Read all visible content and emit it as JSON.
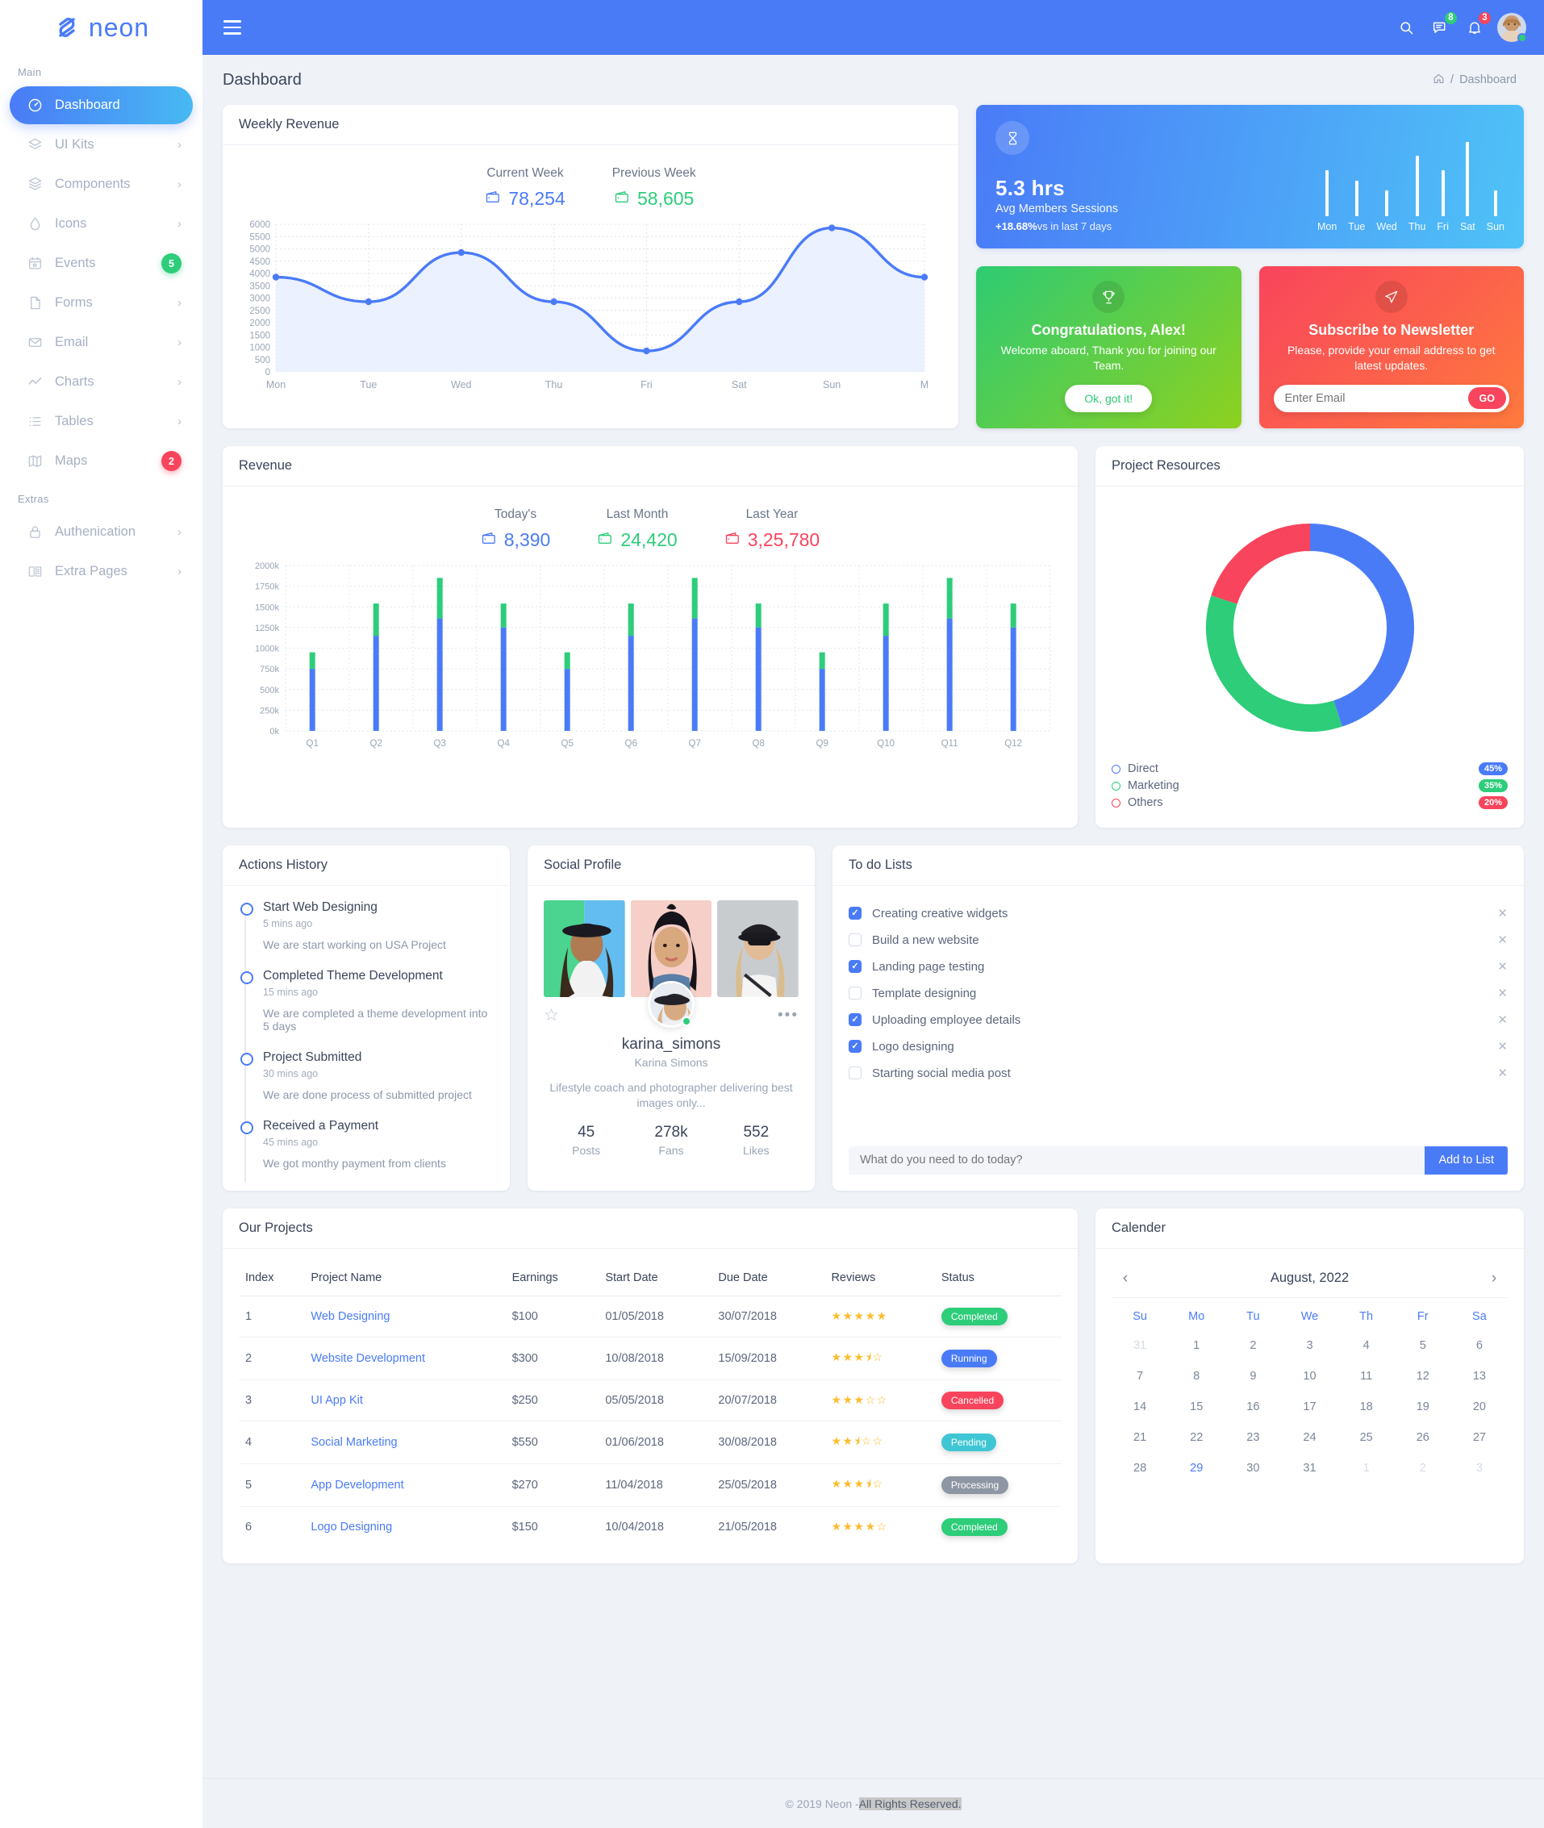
{
  "brand": {
    "name": "neon",
    "logo_icon": "neon-logo-icon"
  },
  "sidebar": {
    "section_main": "Main",
    "section_extras": "Extras",
    "items": [
      {
        "label": "Dashboard",
        "icon": "speedometer-icon",
        "active": true,
        "trailing": ""
      },
      {
        "label": "UI Kits",
        "icon": "layers-icon",
        "trailing": "chevron"
      },
      {
        "label": "Components",
        "icon": "box-icon",
        "trailing": "chevron"
      },
      {
        "label": "Icons",
        "icon": "droplet-icon",
        "trailing": "chevron"
      },
      {
        "label": "Events",
        "icon": "calendar-icon",
        "trailing": "badge",
        "badge": "5",
        "badge_color": "#2dcd7a"
      },
      {
        "label": "Forms",
        "icon": "file-icon",
        "trailing": "chevron"
      },
      {
        "label": "Email",
        "icon": "envelope-icon",
        "trailing": "chevron"
      },
      {
        "label": "Charts",
        "icon": "line-chart-icon",
        "trailing": "chevron"
      },
      {
        "label": "Tables",
        "icon": "list-icon",
        "trailing": "chevron"
      },
      {
        "label": "Maps",
        "icon": "map-icon",
        "trailing": "badge",
        "badge": "2",
        "badge_color": "#f8445c"
      }
    ],
    "extras": [
      {
        "label": "Authenication",
        "icon": "lock-icon",
        "trailing": "chevron"
      },
      {
        "label": "Extra Pages",
        "icon": "book-icon",
        "trailing": "chevron"
      }
    ]
  },
  "topbar": {
    "menu_icon": "hamburger-icon",
    "search_icon": "search-icon",
    "messages_icon": "message-icon",
    "messages_count": "8",
    "notifications_icon": "bell-icon",
    "notifications_count": "3",
    "avatar_icon": "user-avatar"
  },
  "header": {
    "page_title": "Dashboard",
    "breadcrumb_home_icon": "home-icon",
    "breadcrumb_sep": "/",
    "breadcrumb_current": "Dashboard"
  },
  "weekly_revenue": {
    "title": "Weekly Revenue",
    "stats": [
      {
        "label": "Current Week",
        "value": "78,254",
        "icon": "wallet-icon",
        "color": "#4a7bf7"
      },
      {
        "label": "Previous Week",
        "value": "58,605",
        "icon": "wallet-icon",
        "color": "#2dcd7a"
      }
    ]
  },
  "avg_session": {
    "icon": "hourglass-icon",
    "value": "5.3 hrs",
    "label": "Avg Members Sessions",
    "delta": "+18.68%",
    "delta_note": "vs in last 7 days"
  },
  "promo_congrats": {
    "icon": "trophy-icon",
    "title": "Congratulations, Alex!",
    "text": "Welcome aboard, Thank you for joining our Team.",
    "button": "Ok, got it!"
  },
  "promo_newsletter": {
    "icon": "send-icon",
    "title": "Subscribe to Newsletter",
    "text": "Please, provide your email address to get latest updates.",
    "input_placeholder": "Enter Email",
    "input_value": "",
    "button": "GO"
  },
  "revenue": {
    "title": "Revenue",
    "stats": [
      {
        "label": "Today's",
        "value": "8,390",
        "icon": "wallet-icon",
        "color": "#4a7bf7"
      },
      {
        "label": "Last Month",
        "value": "24,420",
        "icon": "wallet-icon",
        "color": "#2dcd7a"
      },
      {
        "label": "Last Year",
        "value": "3,25,780",
        "icon": "wallet-icon",
        "color": "#f8445c"
      }
    ]
  },
  "project_resources": {
    "title": "Project Resources"
  },
  "actions_history": {
    "title": "Actions History",
    "items": [
      {
        "title": "Start Web Designing",
        "time": "5 mins ago",
        "desc": "We are start working on USA Project"
      },
      {
        "title": "Completed Theme Development",
        "time": "15 mins ago",
        "desc": "We are completed a theme development into 5 days"
      },
      {
        "title": "Project Submitted",
        "time": "30 mins ago",
        "desc": "We are done process of submitted project"
      },
      {
        "title": "Received a Payment",
        "time": "45 mins ago",
        "desc": "We got monthy payment from clients"
      }
    ]
  },
  "social_profile": {
    "title": "Social Profile",
    "star_icon": "star-outline-icon",
    "more_icon": "more-dots-icon",
    "username": "karina_simons",
    "fullname": "Karina Simons",
    "bio": "Lifestyle coach and photographer delivering best images only...",
    "stats": [
      {
        "value": "45",
        "label": "Posts"
      },
      {
        "value": "278k",
        "label": "Fans"
      },
      {
        "value": "552",
        "label": "Likes"
      }
    ]
  },
  "todo": {
    "title": "To do Lists",
    "items": [
      {
        "label": "Creating creative widgets",
        "done": true
      },
      {
        "label": "Build a new website",
        "done": false
      },
      {
        "label": "Landing page testing",
        "done": true
      },
      {
        "label": "Template designing",
        "done": false
      },
      {
        "label": "Uploading employee details",
        "done": true
      },
      {
        "label": "Logo designing",
        "done": true
      },
      {
        "label": "Starting social media post",
        "done": false
      }
    ],
    "input_placeholder": "What do you need to do today?",
    "input_value": "",
    "add_button": "Add to List",
    "remove_icon": "close-icon"
  },
  "projects": {
    "title": "Our Projects",
    "columns": [
      "Index",
      "Project Name",
      "Earnings",
      "Start Date",
      "Due Date",
      "Reviews",
      "Status"
    ],
    "rows": [
      {
        "index": "1",
        "name": "Web Designing",
        "earnings": "$100",
        "start": "01/05/2018",
        "due": "30/07/2018",
        "rating": 5,
        "status": "Completed",
        "status_class": "st-completed"
      },
      {
        "index": "2",
        "name": "Website Development",
        "earnings": "$300",
        "start": "10/08/2018",
        "due": "15/09/2018",
        "rating": 3.5,
        "status": "Running",
        "status_class": "st-running"
      },
      {
        "index": "3",
        "name": "UI App Kit",
        "earnings": "$250",
        "start": "05/05/2018",
        "due": "20/07/2018",
        "rating": 3,
        "status": "Cancelled",
        "status_class": "st-cancelled"
      },
      {
        "index": "4",
        "name": "Social Marketing",
        "earnings": "$550",
        "start": "01/06/2018",
        "due": "30/08/2018",
        "rating": 2.5,
        "status": "Pending",
        "status_class": "st-pending"
      },
      {
        "index": "5",
        "name": "App Development",
        "earnings": "$270",
        "start": "11/04/2018",
        "due": "25/05/2018",
        "rating": 3.5,
        "status": "Processing",
        "status_class": "st-processing"
      },
      {
        "index": "6",
        "name": "Logo Designing",
        "earnings": "$150",
        "start": "10/04/2018",
        "due": "21/05/2018",
        "rating": 4,
        "status": "Completed",
        "status_class": "st-completed"
      }
    ]
  },
  "calendar": {
    "title": "Calender",
    "month": "August, 2022",
    "prev_icon": "chevron-left-icon",
    "next_icon": "chevron-right-icon",
    "dow": [
      "Su",
      "Mo",
      "Tu",
      "We",
      "Th",
      "Fr",
      "Sa"
    ],
    "weeks": [
      [
        {
          "d": "31",
          "mut": true
        },
        {
          "d": "1"
        },
        {
          "d": "2"
        },
        {
          "d": "3"
        },
        {
          "d": "4"
        },
        {
          "d": "5"
        },
        {
          "d": "6"
        }
      ],
      [
        {
          "d": "7"
        },
        {
          "d": "8"
        },
        {
          "d": "9"
        },
        {
          "d": "10"
        },
        {
          "d": "11"
        },
        {
          "d": "12"
        },
        {
          "d": "13"
        }
      ],
      [
        {
          "d": "14"
        },
        {
          "d": "15"
        },
        {
          "d": "16"
        },
        {
          "d": "17"
        },
        {
          "d": "18"
        },
        {
          "d": "19"
        },
        {
          "d": "20"
        }
      ],
      [
        {
          "d": "21"
        },
        {
          "d": "22"
        },
        {
          "d": "23"
        },
        {
          "d": "24"
        },
        {
          "d": "25"
        },
        {
          "d": "26"
        },
        {
          "d": "27"
        }
      ],
      [
        {
          "d": "28"
        },
        {
          "d": "29",
          "sel": true
        },
        {
          "d": "30"
        },
        {
          "d": "31"
        },
        {
          "d": "1",
          "mut": true
        },
        {
          "d": "2",
          "mut": true
        },
        {
          "d": "3",
          "mut": true
        }
      ]
    ]
  },
  "footer": {
    "text_before": "© 2019 Neon - ",
    "text_highlight": "All Rights Reserved."
  },
  "chart_data": [
    {
      "type": "area",
      "name": "weekly-revenue-line",
      "title": "Weekly Revenue",
      "categories": [
        "Mon",
        "Tue",
        "Wed",
        "Thu",
        "Fri",
        "Sat",
        "Sun",
        "M"
      ],
      "values": [
        3850,
        2850,
        4850,
        2850,
        850,
        2850,
        5850,
        3850
      ],
      "ylim": [
        0,
        6000
      ],
      "yticks": [
        0,
        500,
        1000,
        1500,
        2000,
        2500,
        3000,
        3500,
        4000,
        4500,
        5000,
        5500,
        6000
      ],
      "xlabel": "",
      "ylabel": "",
      "grid": true,
      "legend": "none",
      "color": "#4a7bf7",
      "fill": "#e8efff"
    },
    {
      "type": "bar",
      "name": "avg-session-minibars",
      "categories": [
        "Mon",
        "Tue",
        "Wed",
        "Thu",
        "Fri",
        "Sat",
        "Sun"
      ],
      "values": [
        62,
        48,
        35,
        82,
        62,
        100,
        35
      ],
      "ylim": [
        0,
        100
      ],
      "color": "#ffffff",
      "grid": false,
      "legend": "none"
    },
    {
      "type": "bar",
      "name": "revenue-stacked-bars",
      "title": "Revenue",
      "categories": [
        "Q1",
        "Q2",
        "Q3",
        "Q4",
        "Q5",
        "Q6",
        "Q7",
        "Q8",
        "Q9",
        "Q10",
        "Q11",
        "Q12"
      ],
      "series": [
        {
          "name": "Base",
          "color": "#4a7bf7",
          "values": [
            750000,
            1150000,
            1360000,
            1250000,
            750000,
            1150000,
            1360000,
            1250000,
            750000,
            1150000,
            1360000,
            1250000
          ]
        },
        {
          "name": "Top",
          "color": "#2dcd7a",
          "values": [
            200000,
            390000,
            490000,
            290000,
            200000,
            390000,
            490000,
            290000,
            200000,
            390000,
            490000,
            290000
          ]
        }
      ],
      "totals": [
        950000,
        1540000,
        1850000,
        1540000,
        950000,
        1540000,
        1850000,
        1540000,
        950000,
        1540000,
        1850000,
        1540000
      ],
      "ylim": [
        0,
        2000000
      ],
      "yticks": [
        "0k",
        "250k",
        "500k",
        "750k",
        "1000k",
        "1250k",
        "1500k",
        "1750k",
        "2000k"
      ],
      "grid": true,
      "legend": "none",
      "stacked": true
    },
    {
      "type": "pie",
      "name": "project-resources-donut",
      "title": "Project Resources",
      "labels": [
        "Direct",
        "Marketing",
        "Others"
      ],
      "values": [
        45,
        35,
        20
      ],
      "display_values": [
        "45%",
        "35%",
        "20%"
      ],
      "colors": [
        "#4a7bf7",
        "#2dcd7a",
        "#f8445c"
      ],
      "donut": true,
      "legend": "bottom-left"
    }
  ]
}
